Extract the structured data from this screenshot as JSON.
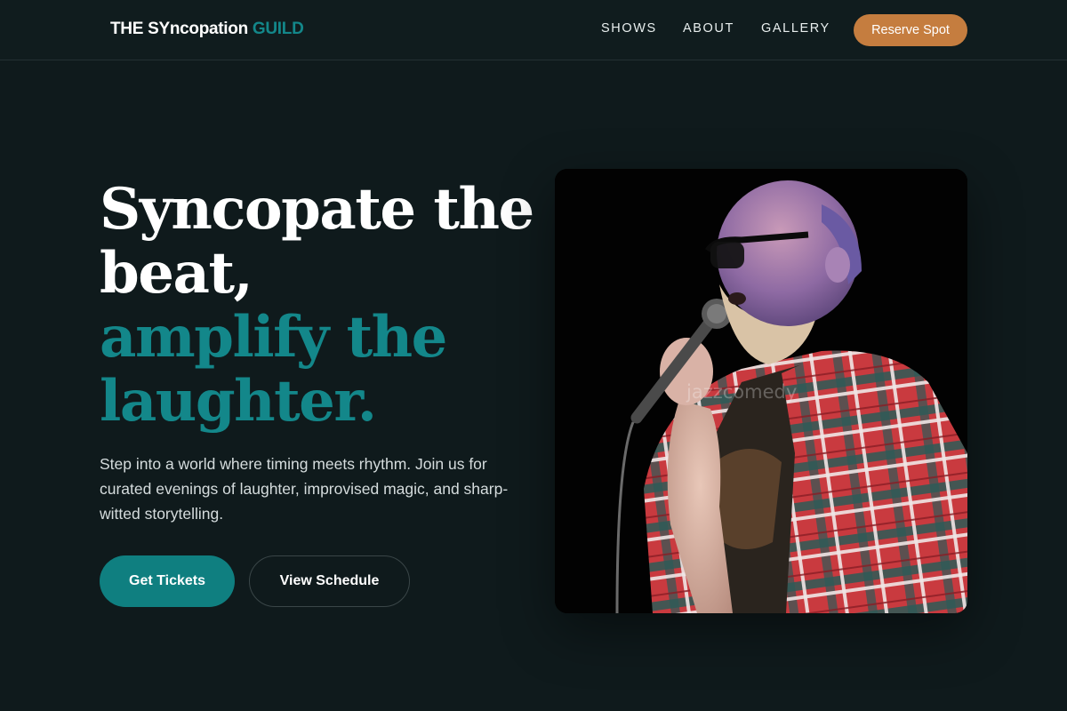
{
  "brand": {
    "name_main": "THE SYncopation",
    "name_accent": "GUILD"
  },
  "nav": {
    "links": [
      {
        "label": "SHOWS"
      },
      {
        "label": "ABOUT"
      },
      {
        "label": "GALLERY"
      }
    ],
    "cta_label": "Reserve Spot"
  },
  "hero": {
    "headline_lines": [
      "Syncopate the",
      "beat,"
    ],
    "headline_accent_lines": [
      "amplify the",
      "laughter."
    ],
    "lead": "Step into a world where timing meets rhythm. Join us for curated evenings of laughter, improvised magic, and sharp-witted storytelling.",
    "primary_button": "Get Tickets",
    "secondary_button": "View Schedule",
    "image_icon": "comedian-photo",
    "image_watermark": "jazzcomedy"
  },
  "colors": {
    "background": "#0f1a1c",
    "accent_teal": "#13878a",
    "button_teal": "#0f7f80",
    "cta_orange": "#c57d3f"
  }
}
